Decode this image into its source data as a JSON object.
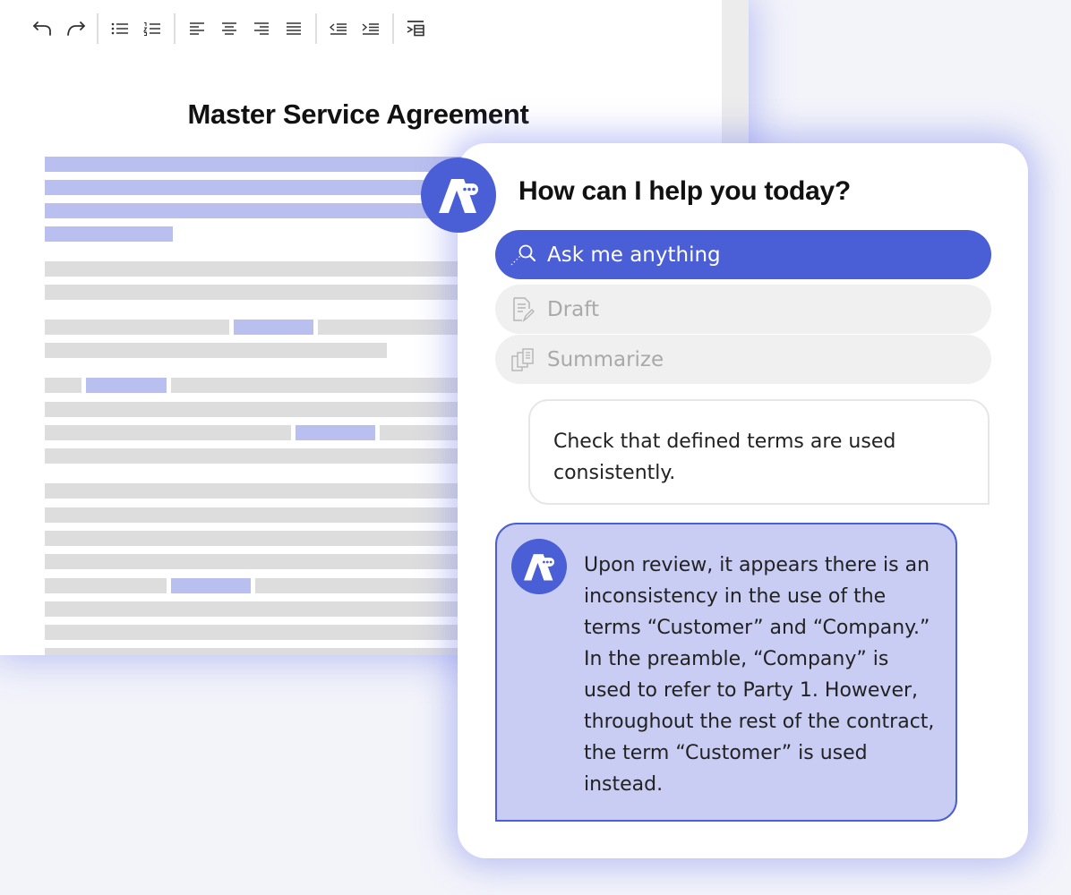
{
  "document": {
    "title": "Master Service Agreement",
    "toolbar": [
      "undo-icon",
      "redo-icon",
      "bullet-list-icon",
      "numbered-list-icon",
      "align-left-icon",
      "align-center-icon",
      "align-right-icon",
      "justify-icon",
      "outdent-icon",
      "indent-icon",
      "text-wrap-icon"
    ]
  },
  "assistant": {
    "heading": "How can I help you today?",
    "modes": [
      {
        "label": "Ask me anything",
        "icon": "magnifier-icon",
        "active": true
      },
      {
        "label": "Draft",
        "icon": "document-pen-icon",
        "active": false
      },
      {
        "label": "Summarize",
        "icon": "documents-stack-icon",
        "active": false
      }
    ],
    "user_message": "Check that defined terms are used consistently.",
    "ai_message": "Upon review, it appears there is an inconsistency in the use of the terms “Customer” and “Company.” In the preamble, “Company” is used to refer to Party 1. However, throughout the rest of the contract, the term “Customer” is used instead."
  },
  "colors": {
    "accent": "#4a5ed6",
    "highlight": "#b9bfee",
    "placeholder_line": "#dddddd",
    "ai_bubble": "#c9cdf3"
  }
}
